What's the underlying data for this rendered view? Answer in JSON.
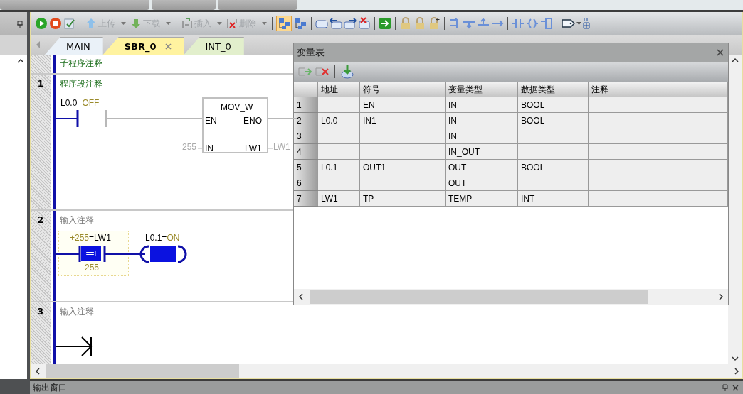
{
  "toolbar": [
    {
      "label": "上传",
      "disabled": true,
      "dropdown": true
    },
    {
      "label": "下载",
      "disabled": true,
      "dropdown": true
    },
    {
      "label": "插入",
      "disabled": true,
      "dropdown": true
    },
    {
      "label": "删除",
      "disabled": true,
      "dropdown": true
    }
  ],
  "editor_tabs": [
    {
      "label": "MAIN",
      "selected": false,
      "closable": false,
      "color": "#eaf1f8"
    },
    {
      "label": "SBR_0",
      "selected": true,
      "closable": true,
      "color": "#fff3a0"
    },
    {
      "label": "INT_0",
      "selected": false,
      "closable": false,
      "color": "#e2efcc"
    }
  ],
  "subroutine_comment": "子程序注释",
  "networks": [
    {
      "number": "1",
      "comment": "程序段注释",
      "kind": "move_box",
      "contact": {
        "operand": "L0.0=",
        "value": "OFF",
        "energized": false
      },
      "box": {
        "title": "MOV_W",
        "en": "EN",
        "eno": "ENO",
        "in": "IN",
        "out": "LW1",
        "in_value": "255",
        "out_value": "LW1"
      }
    },
    {
      "number": "2",
      "placeholder": "输入注释",
      "kind": "compare_coil",
      "compare": {
        "value": "+255",
        "operand": "=LW1",
        "op": "==I",
        "operand2": "255",
        "energized": true
      },
      "coil": {
        "operand": "L0.1=",
        "value": "ON",
        "energized": true
      }
    },
    {
      "number": "3",
      "placeholder": "输入注释",
      "kind": "empty"
    }
  ],
  "variable_table": {
    "title": "变量表",
    "columns": [
      "地址",
      "符号",
      "变量类型",
      "数据类型",
      "注释"
    ],
    "rows": [
      {
        "number": "1",
        "symbol": "EN",
        "var_type": "IN",
        "data_type": "BOOL"
      },
      {
        "number": "2",
        "address": "L0.0",
        "symbol": "IN1",
        "var_type": "IN",
        "data_type": "BOOL"
      },
      {
        "number": "3",
        "var_type": "IN"
      },
      {
        "number": "4",
        "var_type": "IN_OUT"
      },
      {
        "number": "5",
        "address": "L0.1",
        "symbol": "OUT1",
        "var_type": "OUT",
        "data_type": "BOOL"
      },
      {
        "number": "6",
        "var_type": "OUT"
      },
      {
        "number": "7",
        "address": "LW1",
        "symbol": "TP",
        "var_type": "TEMP",
        "data_type": "INT"
      }
    ]
  },
  "output_window": {
    "title": "输出窗口"
  }
}
